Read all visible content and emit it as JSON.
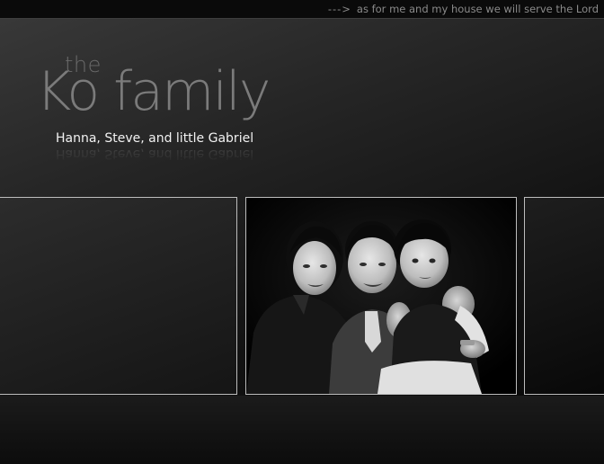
{
  "header": {
    "arrow": "--->",
    "tagline": "as for me and my house we will serve the Lord"
  },
  "logo": {
    "the": "the",
    "family_name": "Ko family"
  },
  "subtitle": "Hanna, Steve, and little Gabriel",
  "gallery": {
    "photo_alt": "Family photo"
  },
  "colors": {
    "background": "#1e1e1e",
    "frame_border": "#bdbdbd",
    "text_light": "#f2f2f2",
    "text_muted": "#8a8a8a"
  }
}
